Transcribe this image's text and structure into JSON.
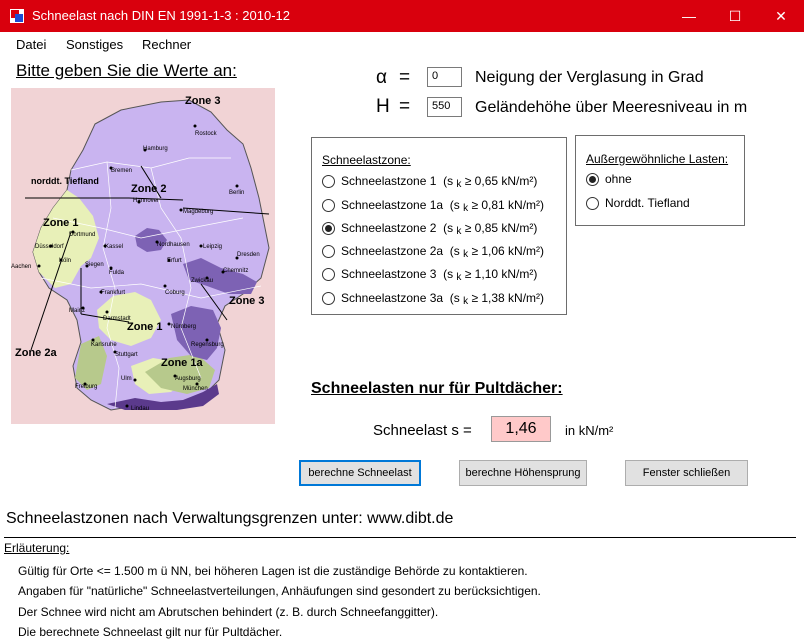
{
  "window": {
    "title": "Schneelast nach DIN EN 1991-1-3 : 2010-12",
    "minimize_glyph": "—",
    "maximize_glyph": "☐",
    "close_glyph": "✕"
  },
  "menu": {
    "items": [
      "Datei",
      "Sonstiges",
      "Rechner"
    ]
  },
  "prompt": "Bitte geben Sie die Werte an:",
  "map": {
    "zone_labels": [
      "Zone 3",
      "Zone 2",
      "Zone 1",
      "Zone 3",
      "Zone 1",
      "Zone 2a",
      "Zone 1a",
      "norddt. Tiefland"
    ],
    "cities": [
      "Rostock",
      "Hamburg",
      "Bremen",
      "Berlin",
      "Hannover",
      "Magdeburg",
      "Dortmund",
      "Düsseldorf",
      "Kassel",
      "Nordhausen",
      "Leipzig",
      "Dresden",
      "Köln",
      "Siegen",
      "Erfurt",
      "Chemnitz",
      "Aachen",
      "Fulda",
      "Zwickau",
      "Frankfurt",
      "Coburg",
      "Mainz",
      "Darmstadt",
      "Nürnberg",
      "Regensburg",
      "Karlsruhe",
      "Stuttgart",
      "Ulm",
      "Augsburg",
      "München",
      "Freiburg",
      "Lindau"
    ]
  },
  "inputs": {
    "alpha": {
      "symbol": "α",
      "equals": "=",
      "value": "0",
      "label": "Neigung der Verglasung in Grad"
    },
    "height": {
      "symbol": "H",
      "equals": "=",
      "value": "550",
      "label": "Geländehöhe über Meeresniveau in m"
    }
  },
  "snowzone_group": {
    "legend": "Schneelastzone:",
    "options": [
      {
        "label": "Schneelastzone 1",
        "pre": "(s",
        "sub": "k",
        "post": "≥ 0,65 kN/m²)",
        "selected": false
      },
      {
        "label": "Schneelastzone 1a",
        "pre": "(s",
        "sub": "k",
        "post": "≥ 0,81 kN/m²)",
        "selected": false
      },
      {
        "label": "Schneelastzone 2",
        "pre": "(s",
        "sub": "k",
        "post": "≥ 0,85 kN/m²)",
        "selected": true
      },
      {
        "label": "Schneelastzone 2a",
        "pre": "(s",
        "sub": "k",
        "post": "≥ 1,06 kN/m²)",
        "selected": false
      },
      {
        "label": "Schneelastzone 3",
        "pre": "(s",
        "sub": "k",
        "post": "≥ 1,10 kN/m²)",
        "selected": false
      },
      {
        "label": "Schneelastzone 3a",
        "pre": "(s",
        "sub": "k",
        "post": "≥ 1,38 kN/m²)",
        "selected": false
      }
    ]
  },
  "special_group": {
    "legend": "Außergewöhnliche Lasten:",
    "options": [
      {
        "label": "ohne",
        "selected": true
      },
      {
        "label": "Norddt. Tiefland",
        "selected": false
      }
    ]
  },
  "result": {
    "title": "Schneelasten nur für Pultdächer:",
    "label": "Schneelast s =",
    "value": "1,46",
    "unit": "in kN/m²"
  },
  "buttons": {
    "calc": "berechne Schneelast",
    "jump": "berechne Höhensprung",
    "close": "Fenster schließen"
  },
  "link_text": "Schneelastzonen nach Verwaltungsgrenzen unter: www.dibt.de",
  "notes": {
    "heading": "Erläuterung:",
    "lines": [
      "Gültig für Orte <= 1.500 m ü NN, bei höheren Lagen ist die zuständige Behörde zu kontaktieren.",
      "Angaben für \"natürliche\" Schneelastverteilungen, Anhäufungen sind gesondert zu berücksichtigen.",
      "Der Schnee wird nicht am Abrutschen behindert (z. B. durch Schneefanggitter).",
      "Die berechnete Schneelast gilt nur für Pultdächer."
    ]
  },
  "colors": {
    "titlebar": "#d9000d",
    "zone1": "#e8f0b8",
    "zone2": "#c9b4f0",
    "zone3": "#7d62b4",
    "zone1a": "#b7c98c",
    "result_bg": "#ffc9c9",
    "default_button_border": "#0078d7"
  }
}
